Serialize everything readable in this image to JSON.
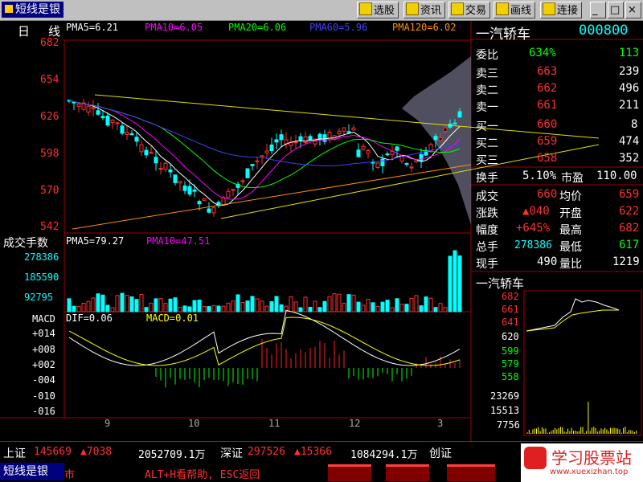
{
  "app": {
    "title": "短线是银"
  },
  "toolbar": {
    "buttons": [
      {
        "label": "选股",
        "icon": "select-icon"
      },
      {
        "label": "资讯",
        "icon": "info-icon"
      },
      {
        "label": "交易",
        "icon": "trade-icon"
      },
      {
        "label": "画线",
        "icon": "draw-icon"
      },
      {
        "label": "连接",
        "icon": "connect-icon"
      }
    ]
  },
  "kline": {
    "period": "日",
    "line_tag": "线",
    "ma": [
      {
        "label": "PMA5=6.21",
        "color": "#ffffff"
      },
      {
        "label": "PMA10=6.05",
        "color": "#ff00ff"
      },
      {
        "label": "PMA20=6.06",
        "color": "#00ff00"
      },
      {
        "label": "PMA60=5.96",
        "color": "#4040ff"
      },
      {
        "label": "PMA120=6.02",
        "color": "#ff9000"
      }
    ],
    "price_ticks": [
      "682",
      "654",
      "626",
      "598",
      "570",
      "542"
    ]
  },
  "volume": {
    "title": "成交手数",
    "ma": [
      {
        "label": "PMA5=79.27",
        "color": "#ffffff"
      },
      {
        "label": "PMA10=47.51",
        "color": "#ff00ff"
      }
    ],
    "ticks": [
      "278386",
      "185590",
      "92795"
    ]
  },
  "macd": {
    "title": "MACD",
    "labels": [
      {
        "label": "DIF=0.06",
        "color": "#ffffff"
      },
      {
        "label": "MACD=0.01",
        "color": "#ffff00"
      }
    ],
    "ticks": [
      "+014",
      "+008",
      "+002",
      "-004",
      "-010",
      "-016"
    ]
  },
  "xaxis": {
    "labels": [
      "9",
      "10",
      "11",
      "12",
      "3"
    ]
  },
  "quote": {
    "name": "一汽轿车",
    "code": "000800",
    "wei_bi": {
      "label": "委比",
      "pct": "634%",
      "val": "113"
    },
    "asks": [
      {
        "label": "卖三",
        "price": "663",
        "vol": "239"
      },
      {
        "label": "卖二",
        "price": "662",
        "vol": "496"
      },
      {
        "label": "卖一",
        "price": "661",
        "vol": "211"
      }
    ],
    "bids": [
      {
        "label": "买一",
        "price": "660",
        "vol": "8"
      },
      {
        "label": "买二",
        "price": "659",
        "vol": "474"
      },
      {
        "label": "买三",
        "price": "658",
        "vol": "352"
      }
    ],
    "turnover": {
      "label": "换手",
      "value": "5.10%",
      "label2": "市盈",
      "value2": "110.00"
    },
    "stats": [
      {
        "l1": "成交",
        "v1": "660",
        "l2": "均价",
        "v2": "659"
      },
      {
        "l1": "涨跌",
        "v1": "▲040",
        "l2": "开盘",
        "v2": "622"
      },
      {
        "l1": "幅度",
        "v1": "+645%",
        "l2": "最高",
        "v2": "682"
      },
      {
        "l1": "总手",
        "v1": "278386",
        "l2": "最低",
        "v2": "617"
      },
      {
        "l1": "现手",
        "v1": "490",
        "l2": "量比",
        "v2": "1219"
      }
    ],
    "mini_title": "一汽轿车",
    "mini_price_ticks": [
      "682",
      "661",
      "641",
      "620",
      "599",
      "579",
      "558"
    ],
    "mini_vol_ticks": [
      "23269",
      "15513",
      "7756"
    ]
  },
  "status": {
    "sh_label": "上证",
    "sh_index": "145669",
    "sh_change": "▲7038",
    "sh_amount": "2052709.1万",
    "sz_label": "深证",
    "sz_index": "297526",
    "sz_change": "▲15366",
    "sz_amount": "1084294.1万",
    "cy_label": "创证",
    "app_label": "短线是银",
    "mkt": "市",
    "help": "ALT+H看帮助, ESC返回"
  },
  "watermark": {
    "title": "学习股票站",
    "url": "www.xuexizhan.top"
  }
}
